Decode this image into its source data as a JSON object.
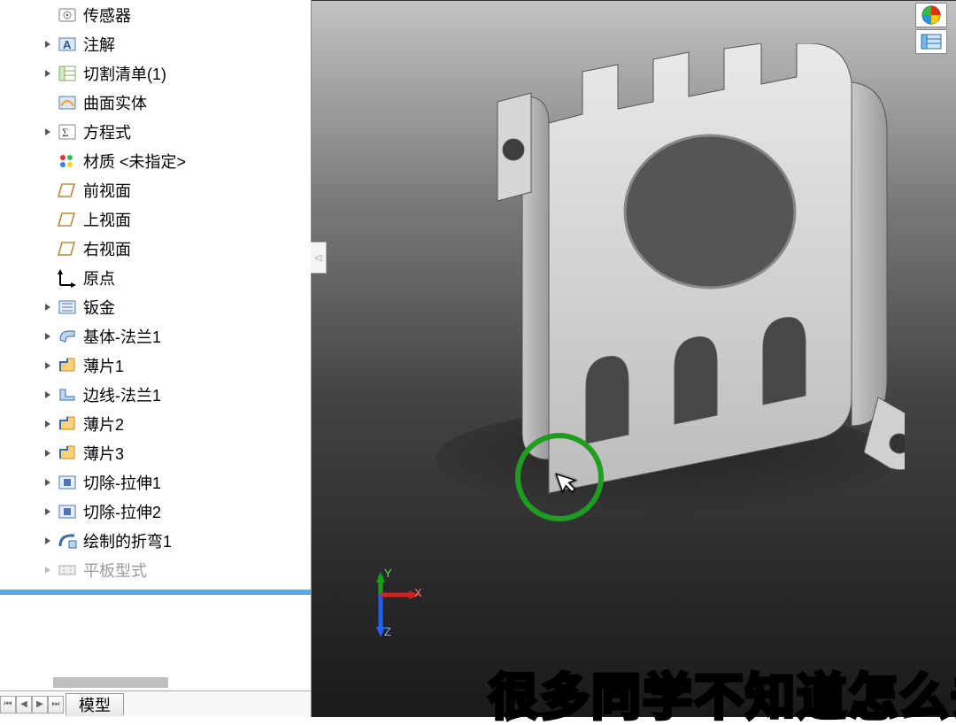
{
  "tree": {
    "items": [
      {
        "label": "传感器",
        "icon": "sensor",
        "expandable": false,
        "greyed": false
      },
      {
        "label": "注解",
        "icon": "annotation",
        "expandable": true,
        "greyed": false
      },
      {
        "label": "切割清单(1)",
        "icon": "cutlist",
        "expandable": true,
        "greyed": false
      },
      {
        "label": "曲面实体",
        "icon": "surface",
        "expandable": false,
        "greyed": false
      },
      {
        "label": "方程式",
        "icon": "equation",
        "expandable": true,
        "greyed": false
      },
      {
        "label": "材质 <未指定>",
        "icon": "material",
        "expandable": false,
        "greyed": false
      },
      {
        "label": "前视面",
        "icon": "plane",
        "expandable": false,
        "greyed": false
      },
      {
        "label": "上视面",
        "icon": "plane",
        "expandable": false,
        "greyed": false
      },
      {
        "label": "右视面",
        "icon": "plane",
        "expandable": false,
        "greyed": false
      },
      {
        "label": "原点",
        "icon": "origin",
        "expandable": false,
        "greyed": false
      },
      {
        "label": "钣金",
        "icon": "sheetmetal",
        "expandable": true,
        "greyed": false
      },
      {
        "label": "基体-法兰1",
        "icon": "baseflange",
        "expandable": true,
        "greyed": false
      },
      {
        "label": "薄片1",
        "icon": "tab",
        "expandable": true,
        "greyed": false
      },
      {
        "label": "边线-法兰1",
        "icon": "edgeflange",
        "expandable": true,
        "greyed": false
      },
      {
        "label": "薄片2",
        "icon": "tab",
        "expandable": true,
        "greyed": false
      },
      {
        "label": "薄片3",
        "icon": "tab",
        "expandable": true,
        "greyed": false
      },
      {
        "label": "切除-拉伸1",
        "icon": "cutextrude",
        "expandable": true,
        "greyed": false
      },
      {
        "label": "切除-拉伸2",
        "icon": "cutextrude",
        "expandable": true,
        "greyed": false
      },
      {
        "label": "绘制的折弯1",
        "icon": "sketchbend",
        "expandable": true,
        "greyed": false
      },
      {
        "label": "平板型式",
        "icon": "flatpattern",
        "expandable": true,
        "greyed": true
      }
    ]
  },
  "tab": {
    "model": "模型"
  },
  "triad": {
    "x": "X",
    "y": "Y",
    "z": "Z"
  },
  "caption": "很多同学不知道怎么去调整",
  "icons": {
    "sensor": "sensor-icon",
    "annotation": "annotation-icon",
    "cutlist": "cutlist-icon",
    "surface": "surface-icon",
    "equation": "equation-icon",
    "material": "material-icon",
    "plane": "plane-icon",
    "origin": "origin-icon",
    "sheetmetal": "sheetmetal-icon",
    "baseflange": "baseflange-icon",
    "tab": "tab-icon",
    "edgeflange": "edgeflange-icon",
    "cutextrude": "cutextrude-icon",
    "sketchbend": "sketchbend-icon",
    "flatpattern": "flatpattern-icon"
  }
}
